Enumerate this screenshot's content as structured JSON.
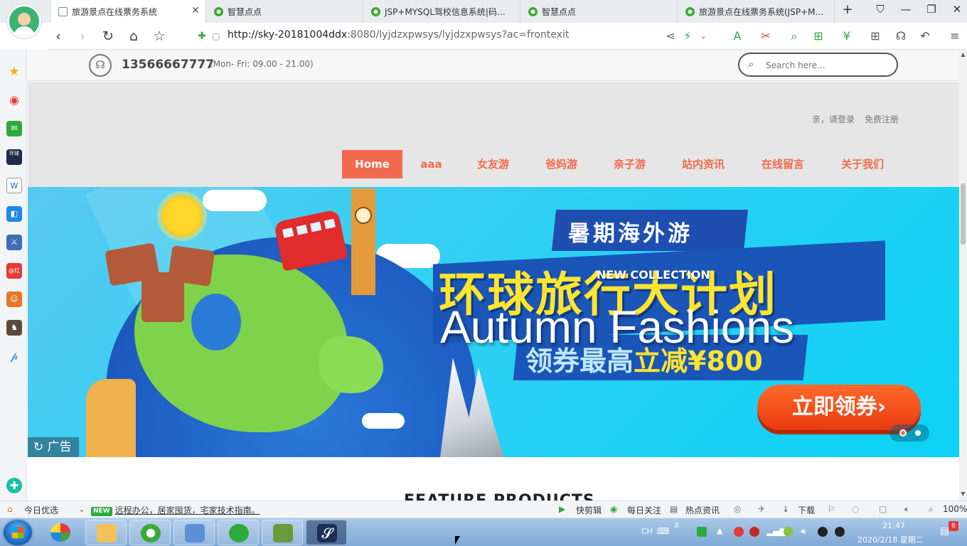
{
  "browser": {
    "tabs": [
      {
        "title": "旅游景点在线票务系统",
        "active": true
      },
      {
        "title": "智慧点点",
        "active": false
      },
      {
        "title": "JSP+MYSQL驾校信息系统|码…",
        "active": false
      },
      {
        "title": "智慧点点",
        "active": false
      },
      {
        "title": "旅游景点在线票务系统(JSP+M…",
        "active": false
      }
    ],
    "new_tab": "+",
    "url_host": "http://sky-20181004ddx",
    "url_rest": ":8080/lyjdzxpwsys/lyjdzxpwsys?ac=frontexit"
  },
  "site": {
    "phone": "13566667777",
    "hours": "(Mon- Fri: 09.00 - 21.00)",
    "search_placeholder": "Search here...",
    "login": "亲，请登录",
    "register": "免费注册",
    "menu": [
      "Home",
      "aaa",
      "女友游",
      "爸妈游",
      "亲子游",
      "站内资讯",
      "在线留言",
      "关于我们"
    ],
    "banner": {
      "label": "NEW COLLECTION",
      "title": "Autumn Fashions",
      "poster_title": "暑期海外游",
      "poster_big": "环球旅行大计划",
      "poster_sub_a": "领券最高",
      "poster_sub_b": "立减¥800",
      "cta": "立即领券›",
      "ad_tag": "广告"
    },
    "section_heading": "FEATURE PRODUCTS"
  },
  "statusbar": {
    "today": "今日优选",
    "new_badge": "NEW",
    "news": "远程办公，居家囤货，宅家技术指南。",
    "clip": "快剪辑",
    "daily": "每日关注",
    "hot": "热点资讯",
    "download": "下载",
    "zoom": "100%"
  },
  "taskbar": {
    "lang": "CH",
    "time": "21:47",
    "date": "2020/2/18 星期二",
    "notif_count": "6"
  }
}
